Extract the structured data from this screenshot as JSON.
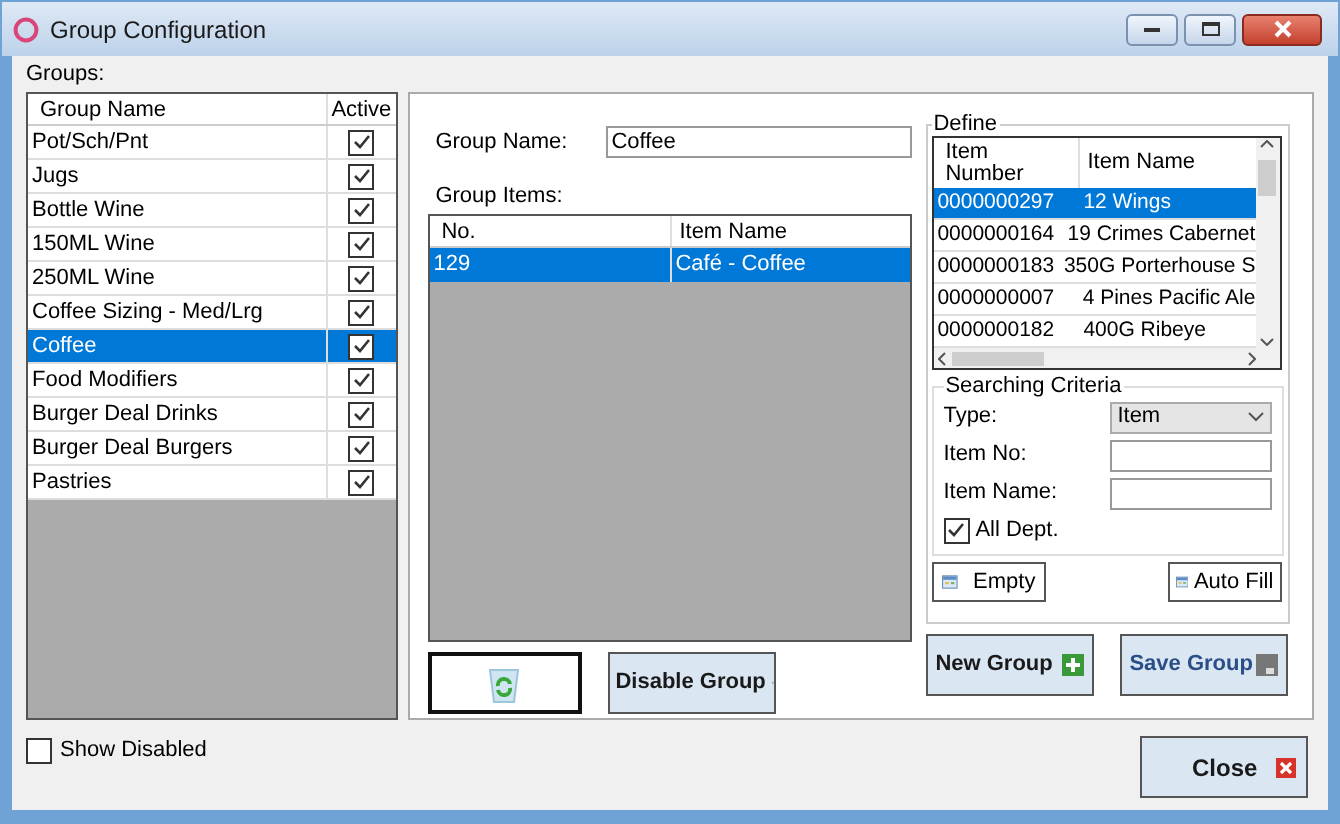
{
  "window": {
    "title": "Group Configuration"
  },
  "groups": {
    "label": "Groups:",
    "columns": [
      "Group Name",
      "Active"
    ],
    "rows": [
      {
        "name": "Pot/Sch/Pnt",
        "active": true,
        "selected": false
      },
      {
        "name": "Jugs",
        "active": true,
        "selected": false
      },
      {
        "name": "Bottle Wine",
        "active": true,
        "selected": false
      },
      {
        "name": "150ML Wine",
        "active": true,
        "selected": false
      },
      {
        "name": "250ML Wine",
        "active": true,
        "selected": false
      },
      {
        "name": "Coffee Sizing - Med/Lrg",
        "active": true,
        "selected": false
      },
      {
        "name": "Coffee",
        "active": true,
        "selected": true
      },
      {
        "name": "Food Modifiers",
        "active": true,
        "selected": false
      },
      {
        "name": "Burger Deal Drinks",
        "active": true,
        "selected": false
      },
      {
        "name": "Burger Deal Burgers",
        "active": true,
        "selected": false
      },
      {
        "name": "Pastries",
        "active": true,
        "selected": false
      }
    ]
  },
  "show_disabled": {
    "label": "Show Disabled",
    "checked": false
  },
  "group_name": {
    "label": "Group Name:",
    "value": "Coffee"
  },
  "group_items": {
    "label": "Group Items:",
    "columns": [
      "No.",
      "Item Name"
    ],
    "rows": [
      {
        "no": "129",
        "name": "Café - Coffee",
        "selected": true
      }
    ]
  },
  "define": {
    "title": "Define",
    "columns": [
      "Item Number",
      "Item Name"
    ],
    "rows": [
      {
        "number": "0000000297",
        "name": "12 Wings",
        "selected": true
      },
      {
        "number": "0000000164",
        "name": "19 Crimes Cabernet",
        "selected": false
      },
      {
        "number": "0000000183",
        "name": "350G Porterhouse S",
        "selected": false
      },
      {
        "number": "0000000007",
        "name": "4 Pines Pacific Ale",
        "selected": false
      },
      {
        "number": "0000000182",
        "name": "400G Ribeye",
        "selected": false
      }
    ]
  },
  "search": {
    "title": "Searching Criteria",
    "type": {
      "label": "Type:",
      "value": "Item"
    },
    "item_no": {
      "label": "Item No:"
    },
    "item_name": {
      "label": "Item Name:"
    },
    "all_dept": {
      "label": "All Dept.",
      "checked": true
    }
  },
  "buttons": {
    "empty": "Empty",
    "auto_fill": "Auto Fill",
    "disable_group": "Disable Group",
    "new_group": "New Group",
    "save_group": "Save Group",
    "close": "Close"
  }
}
